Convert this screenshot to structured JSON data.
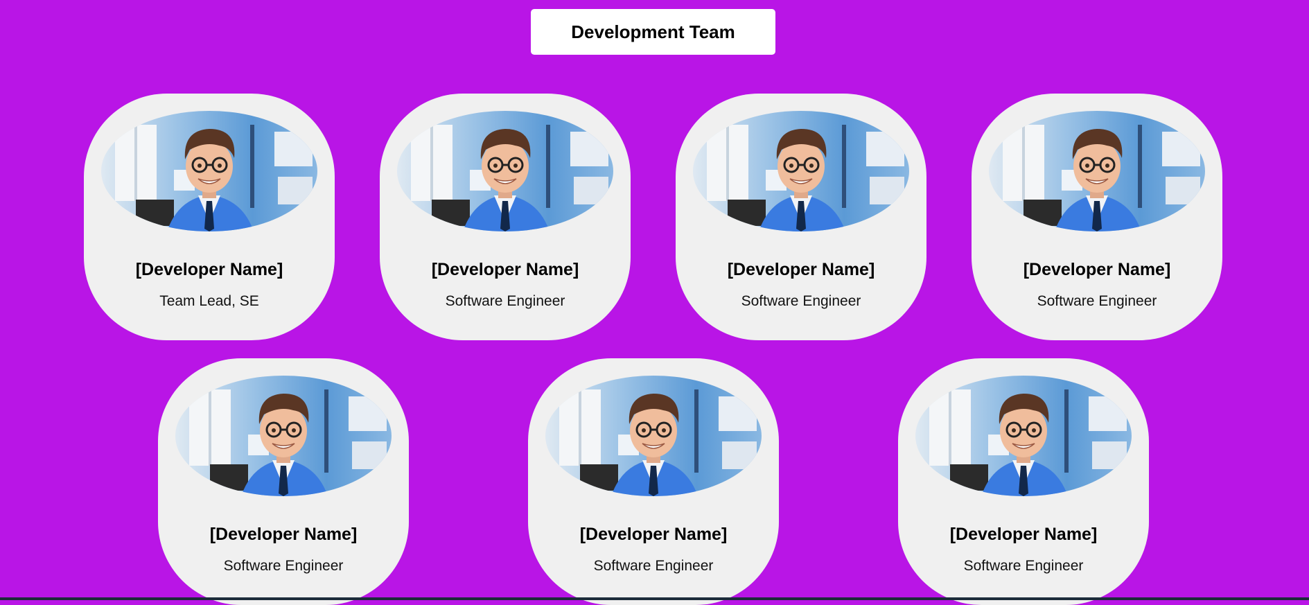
{
  "header": {
    "title": "Development Team"
  },
  "team": [
    {
      "name": "[Developer Name]",
      "role": "Team Lead, SE",
      "avatar_icon": "developer-avatar-icon"
    },
    {
      "name": "[Developer Name]",
      "role": "Software Engineer",
      "avatar_icon": "developer-avatar-icon"
    },
    {
      "name": "[Developer Name]",
      "role": "Software Engineer",
      "avatar_icon": "developer-avatar-icon"
    },
    {
      "name": "[Developer Name]",
      "role": "Software Engineer",
      "avatar_icon": "developer-avatar-icon"
    },
    {
      "name": "[Developer Name]",
      "role": "Software Engineer",
      "avatar_icon": "developer-avatar-icon"
    },
    {
      "name": "[Developer Name]",
      "role": "Software Engineer",
      "avatar_icon": "developer-avatar-icon"
    },
    {
      "name": "[Developer Name]",
      "role": "Software Engineer",
      "avatar_icon": "developer-avatar-icon"
    }
  ],
  "colors": {
    "background": "#b915e6",
    "card": "#f0f0f0",
    "title_box": "#ffffff"
  }
}
